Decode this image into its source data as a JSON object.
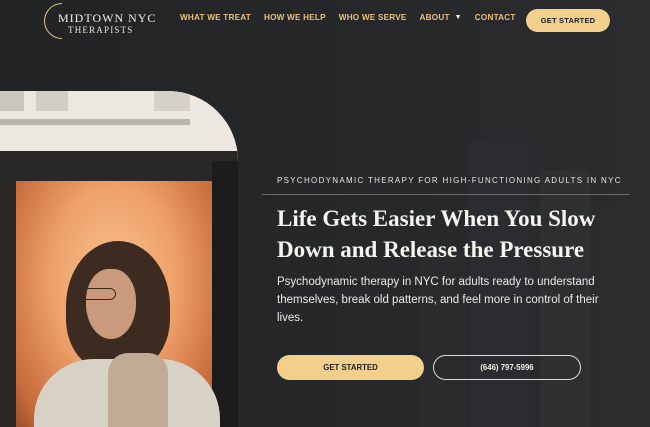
{
  "logo": {
    "line1": "MIDTOWN NYC",
    "line2": "THERAPISTS"
  },
  "nav": {
    "items": [
      {
        "label": "WHAT WE TREAT"
      },
      {
        "label": "HOW WE HELP"
      },
      {
        "label": "WHO WE SERVE"
      },
      {
        "label": "ABOUT",
        "has_dropdown": true
      },
      {
        "label": "CONTACT"
      }
    ],
    "cta_label": "GET STARTED"
  },
  "hero": {
    "eyebrow": "PSYCHODYNAMIC THERAPY FOR HIGH-FUNCTIONING ADULTS IN NYC",
    "headline": "Life Gets Easier When You Slow Down and Release the Pressure",
    "subcopy": "Psychodynamic therapy in NYC for adults ready to understand themselves, break old patterns, and feel more in control of their lives.",
    "primary_button": "GET STARTED",
    "phone_button": "(646) 797-5996"
  },
  "colors": {
    "background": "#232425",
    "accent": "#f2cf8d",
    "nav_text": "#e8c07e",
    "text": "#f2f0ea"
  },
  "icons": {
    "dropdown": "chevron-down-icon"
  }
}
